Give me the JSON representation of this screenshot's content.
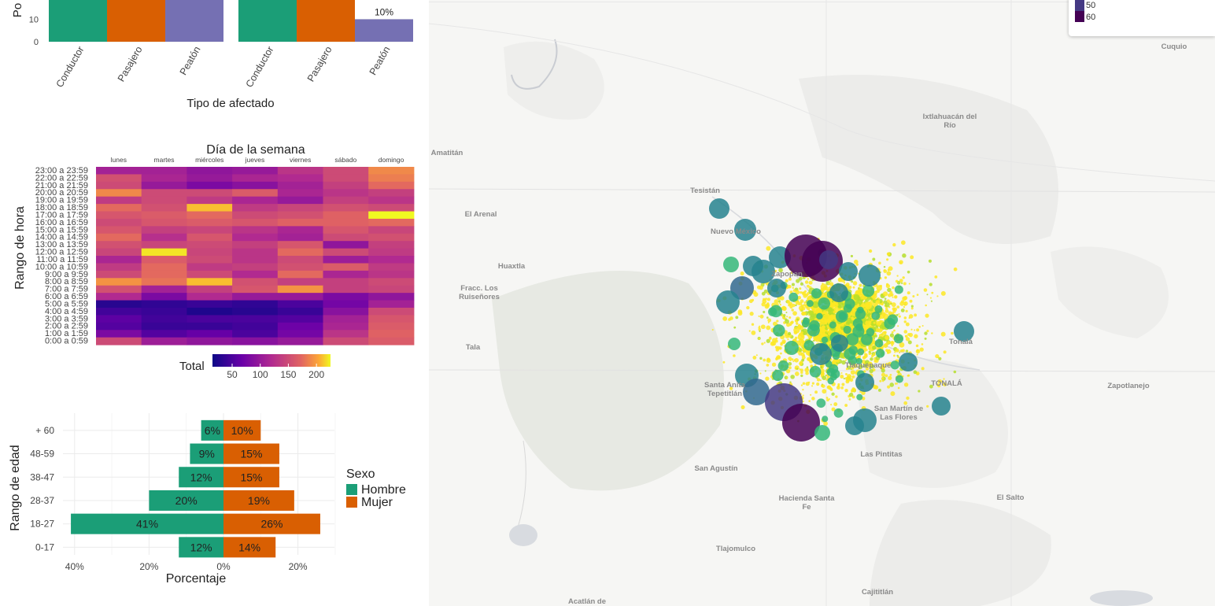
{
  "bar_chart": {
    "y_axis_label": "Po",
    "y_ticks": [
      "10",
      "0"
    ],
    "x_axis_title": "Tipo de afectado",
    "panels": [
      {
        "categories": [
          "Conductor",
          "Pasajero",
          "Peatón"
        ],
        "values": [
          50,
          40,
          40
        ],
        "labels": [
          "",
          "",
          ""
        ]
      },
      {
        "categories": [
          "Conductor",
          "Pasajero",
          "Peatón"
        ],
        "values": [
          50,
          40,
          10
        ],
        "labels": [
          "",
          "",
          "10%"
        ]
      }
    ],
    "colors": [
      "#1b9e77",
      "#d95f02",
      "#7570b3"
    ]
  },
  "heatmap": {
    "title": "Día de la semana",
    "y_axis_label": "Rango de hora",
    "days": [
      "lunes",
      "martes",
      "miércoles",
      "jueves",
      "viernes",
      "sábado",
      "domingo"
    ],
    "hours": [
      "23:00 a 23:59",
      "22:00 a 22:59",
      "21:00 a 21:59",
      "20:00 a 20:59",
      "19:00 a 19:59",
      "18:00 a 18:59",
      "17:00 a 17:59",
      "16:00 a 16:59",
      "15:00 a 15:59",
      "14:00 a 14:59",
      "13:00 a 13:59",
      "12:00 a 12:59",
      "11:00 a 11:59",
      "10:00 a 10:59",
      "9:00 a 9:59",
      "8:00 a 8:59",
      "7:00 a 7:59",
      "6:00 a 6:59",
      "5:00 a 5:59",
      "4:00 a 4:59",
      "3:00 a 3:59",
      "2:00 a 2:59",
      "1:00 a 1:59",
      "0:00 a 0:59"
    ],
    "values": [
      [
        110,
        110,
        95,
        100,
        130,
        150,
        190
      ],
      [
        155,
        115,
        100,
        115,
        120,
        150,
        185
      ],
      [
        150,
        100,
        80,
        90,
        110,
        140,
        175
      ],
      [
        190,
        150,
        150,
        165,
        115,
        130,
        140
      ],
      [
        135,
        150,
        135,
        115,
        100,
        140,
        130
      ],
      [
        175,
        155,
        210,
        135,
        145,
        155,
        150
      ],
      [
        160,
        165,
        175,
        150,
        155,
        170,
        225
      ],
      [
        150,
        160,
        165,
        160,
        170,
        170,
        175
      ],
      [
        160,
        140,
        145,
        130,
        115,
        160,
        145
      ],
      [
        175,
        125,
        160,
        120,
        110,
        150,
        155
      ],
      [
        155,
        145,
        150,
        140,
        160,
        95,
        140
      ],
      [
        145,
        220,
        145,
        130,
        175,
        150,
        135
      ],
      [
        115,
        165,
        150,
        130,
        150,
        105,
        120
      ],
      [
        135,
        175,
        135,
        140,
        155,
        165,
        135
      ],
      [
        150,
        175,
        150,
        120,
        175,
        115,
        130
      ],
      [
        195,
        180,
        210,
        155,
        140,
        140,
        150
      ],
      [
        155,
        110,
        140,
        160,
        195,
        140,
        145
      ],
      [
        120,
        80,
        120,
        100,
        100,
        80,
        95
      ],
      [
        30,
        35,
        40,
        35,
        50,
        75,
        110
      ],
      [
        45,
        40,
        25,
        30,
        40,
        90,
        150
      ],
      [
        60,
        45,
        50,
        50,
        55,
        110,
        160
      ],
      [
        55,
        40,
        40,
        45,
        70,
        115,
        165
      ],
      [
        80,
        55,
        65,
        50,
        75,
        130,
        170
      ],
      [
        150,
        105,
        95,
        90,
        100,
        150,
        165
      ]
    ],
    "legend_title": "Total",
    "legend_ticks": [
      "50",
      "100",
      "150",
      "200"
    ],
    "legend_range": [
      15,
      225
    ]
  },
  "pyramid": {
    "y_axis_label": "Rango de edad",
    "x_axis_title": "Porcentaje",
    "x_ticks": [
      "40%",
      "20%",
      "0%",
      "20%"
    ],
    "groups": [
      "+ 60",
      "48-59",
      "38-47",
      "28-37",
      "18-27",
      "0-17"
    ],
    "hombre": [
      6,
      9,
      12,
      20,
      41,
      12
    ],
    "mujer": [
      10,
      15,
      15,
      19,
      26,
      14
    ],
    "hombre_labels": [
      "6%",
      "9%",
      "12%",
      "20%",
      "41%",
      "12%"
    ],
    "mujer_labels": [
      "10%",
      "15%",
      "15%",
      "19%",
      "26%",
      "14%"
    ],
    "legend_title": "Sexo",
    "legend_items": [
      "Hombre",
      "Mujer"
    ],
    "colors": {
      "hombre": "#1b9e77",
      "mujer": "#d95f02"
    }
  },
  "map": {
    "places": [
      {
        "name": "Cuquio",
        "x": 1492,
        "y": 59
      },
      {
        "name": "Ixtlahuacán del\nRío",
        "x": 1207,
        "y": 148
      },
      {
        "name": "Amatitán",
        "x": 568,
        "y": 194
      },
      {
        "name": "Tesistán",
        "x": 896,
        "y": 242
      },
      {
        "name": "El Arenal",
        "x": 611,
        "y": 272
      },
      {
        "name": "Nuevo México",
        "x": 935,
        "y": 294
      },
      {
        "name": "Huaxtla",
        "x": 650,
        "y": 338
      },
      {
        "name": "Fracc. Los\nRuiseñores",
        "x": 609,
        "y": 366
      },
      {
        "name": "Zapopan",
        "x": 1000,
        "y": 348
      },
      {
        "name": "Tala",
        "x": 601,
        "y": 441
      },
      {
        "name": "Tonalá",
        "x": 1221,
        "y": 434
      },
      {
        "name": "Tlaquepaque",
        "x": 1103,
        "y": 464
      },
      {
        "name": "Santa Anita\nTepetitlán",
        "x": 921,
        "y": 489
      },
      {
        "name": "TONALÁ",
        "x": 1203,
        "y": 487
      },
      {
        "name": "Zapotlanejo",
        "x": 1434,
        "y": 490
      },
      {
        "name": "San Martín de\nLas Flores",
        "x": 1142,
        "y": 519
      },
      {
        "name": "Las Pintitas",
        "x": 1120,
        "y": 577
      },
      {
        "name": "San Agustín",
        "x": 910,
        "y": 595
      },
      {
        "name": "Hacienda Santa\nFe",
        "x": 1025,
        "y": 633
      },
      {
        "name": "El Salto",
        "x": 1284,
        "y": 632
      },
      {
        "name": "Tlajomulco",
        "x": 935,
        "y": 697
      },
      {
        "name": "Cajititlán",
        "x": 1115,
        "y": 752
      },
      {
        "name": "Acatlán de",
        "x": 746,
        "y": 764
      }
    ],
    "legend_items": [
      "50",
      "60"
    ],
    "point_colors": [
      "#fde725",
      "#b5de2b",
      "#35b779",
      "#26828e",
      "#31688e",
      "#443983",
      "#440154"
    ]
  }
}
